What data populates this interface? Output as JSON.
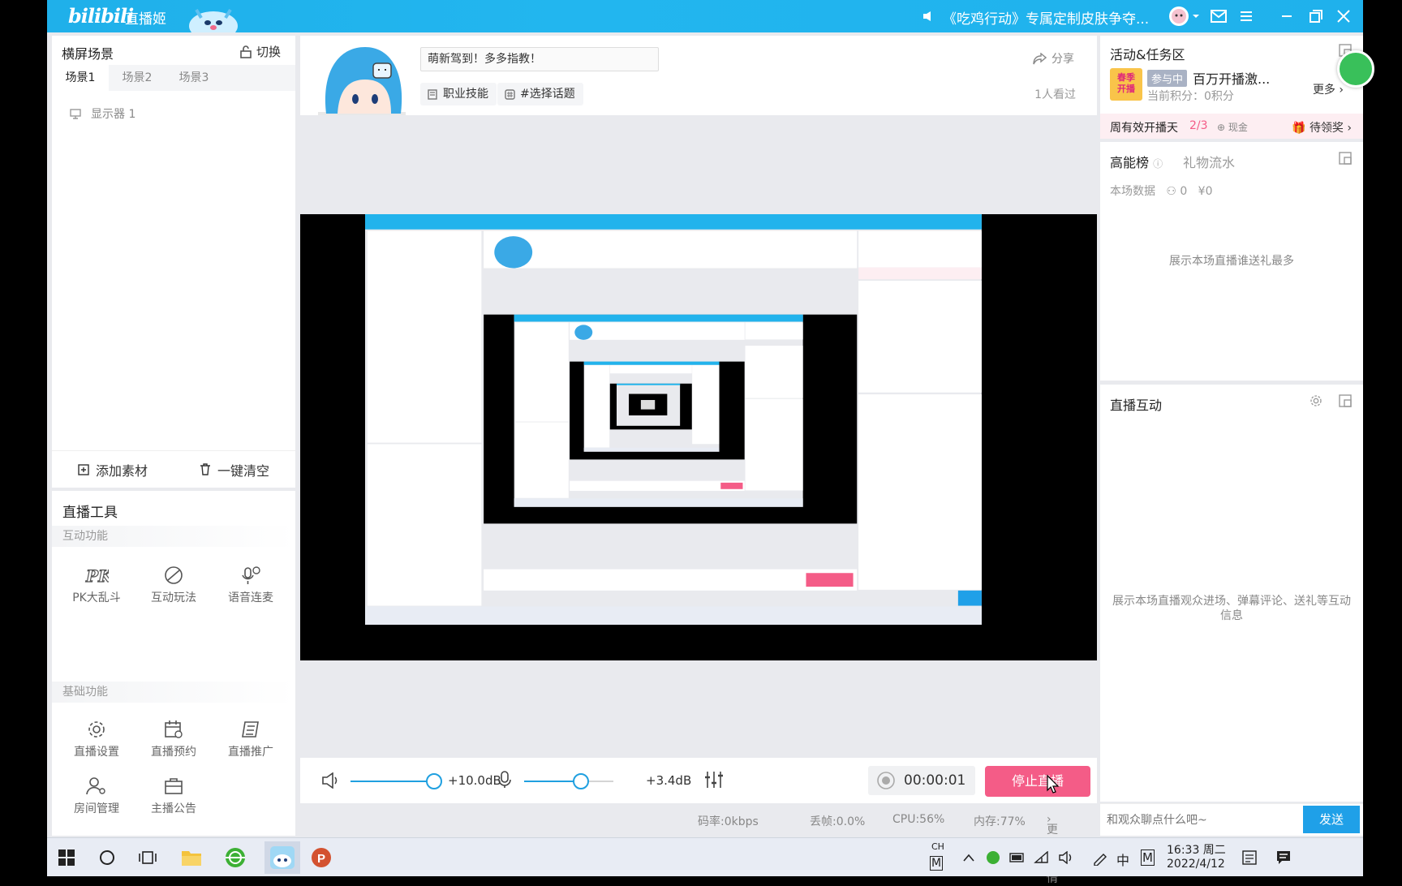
{
  "titlebar": {
    "logo": "bilibili",
    "app_name": "直播姬",
    "notice": "《吃鸡行动》专属定制皮肤争夺..."
  },
  "scene_panel": {
    "title": "横屏场景",
    "switch_label": "切换",
    "tabs": [
      "场景1",
      "场景2",
      "场景3"
    ],
    "active_tab": 0,
    "source_item": "显示器 1",
    "add_label": "添加素材",
    "clear_label": "一键清空"
  },
  "tools": {
    "title": "直播工具",
    "interactive_label": "互动功能",
    "interactive": [
      "PK大乱斗",
      "互动玩法",
      "语音连麦"
    ],
    "basic_label": "基础功能",
    "basic": [
      "直播设置",
      "直播预约",
      "直播推广",
      "房间管理",
      "主播公告"
    ]
  },
  "info": {
    "title_value": "萌新驾到！多多指教！",
    "skill_chip": "职业技能",
    "topic_chip": "#选择话题",
    "share": "分享",
    "viewers": "1人看过"
  },
  "audio": {
    "speaker_db": "+10.0dB",
    "speaker_level": 0.94,
    "mic_db": "+3.4dB",
    "mic_level": 0.64,
    "timer": "00:00:01",
    "stop_label": "停止直播"
  },
  "status": {
    "bitrate": "码率:0kbps",
    "dropped": "丢帧:0.0%",
    "cpu": "CPU:56%",
    "memory": "内存:77%",
    "more": "更多详情"
  },
  "activity": {
    "title": "活动&任务区",
    "badge": "参与中",
    "campaign": "百万开播激...",
    "points": "当前积分：0积分",
    "more": "更多",
    "logo_text_1": "春季",
    "logo_text_2": "开播"
  },
  "weekly": {
    "label": "周有效开播天",
    "progress": "2/3",
    "reward_type": "现金",
    "pending": "待领奖"
  },
  "rank": {
    "tab_energy": "高能榜",
    "tab_gift": "礼物流水",
    "session_label": "本场数据",
    "people": "0",
    "money": "¥0",
    "empty_text": "展示本场直播谁送礼最多"
  },
  "interact": {
    "title": "直播互动",
    "empty_text": "展示本场直播观众进场、弹幕评论、送礼等互动信息"
  },
  "chat": {
    "placeholder": "和观众聊点什么吧~",
    "send": "发送"
  },
  "taskbar": {
    "ime_top": "CH",
    "ime_bottom": "M",
    "lang": "中",
    "ime_mode": "M",
    "time": "16:33 周二",
    "date": "2022/4/12"
  }
}
